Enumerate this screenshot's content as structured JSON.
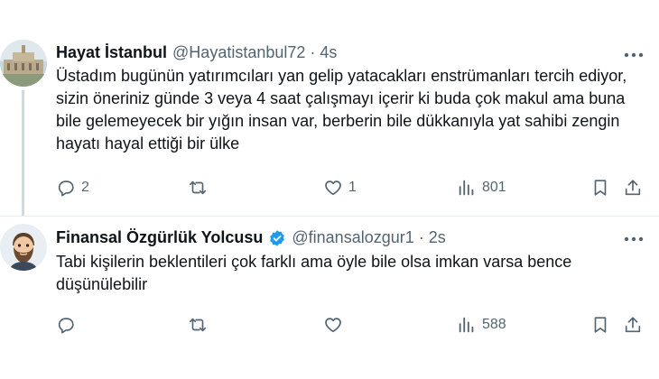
{
  "tweets": [
    {
      "name": "Hayat İstanbul",
      "handle": "@Hayatistanbul72",
      "separator": "·",
      "time": "4s",
      "text": "Üstadım bugünün yatırımcıları yan gelip yatacakları enstrümanları tercih ediyor, sizin öneriniz günde 3 veya 4 saat çalışmayı içerir ki buda çok makul ama buna bile gelemeyecek bir yığın insan var, berberin bile dükkanıyla yat sahibi zengin hayatı hayal ettiği bir ülke",
      "replies": "2",
      "retweets": "",
      "likes": "1",
      "views": "801",
      "avatar_icon": "palace-photo-avatar",
      "verified": false
    },
    {
      "name": "Finansal Özgürlük Yolcusu",
      "handle": "@finansalozgur1",
      "separator": "·",
      "time": "2s",
      "text": "Tabi kişilerin beklentileri çok farklı ama öyle bile olsa imkan varsa bence düşünülebilir",
      "replies": "",
      "retweets": "",
      "likes": "",
      "views": "588",
      "avatar_icon": "bearded-man-avatar",
      "verified": true
    }
  ],
  "colors": {
    "text_primary": "#0f1419",
    "text_secondary": "#536471",
    "verified_blue": "#1d9bf0",
    "divider": "#e6ecf0",
    "thread_line": "#cfd9de"
  },
  "icons": [
    "reply-icon",
    "retweet-icon",
    "like-icon",
    "views-icon",
    "bookmark-icon",
    "share-icon",
    "more-icon",
    "verified-badge-icon"
  ]
}
